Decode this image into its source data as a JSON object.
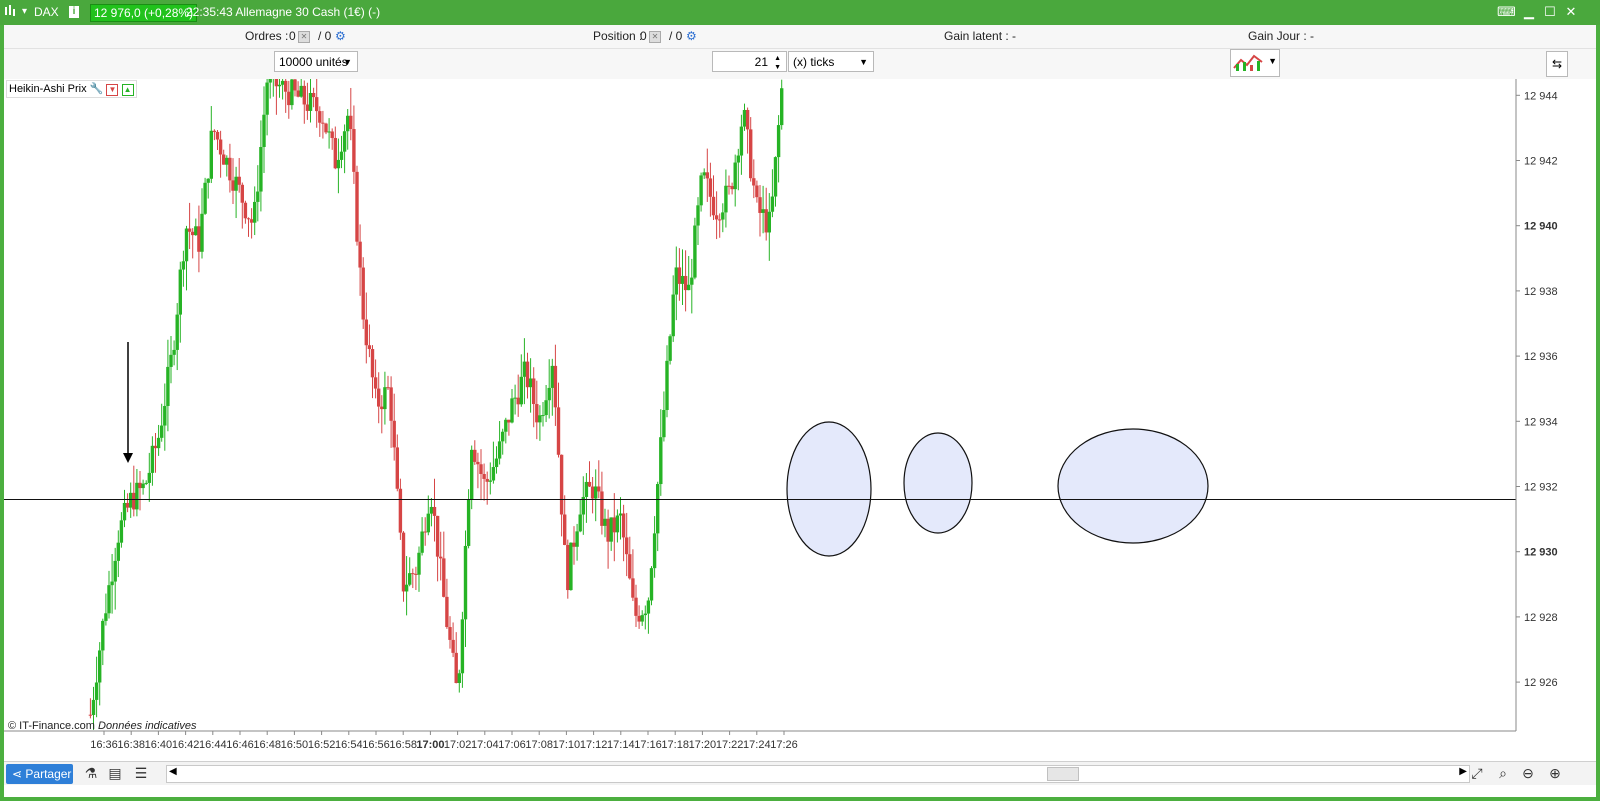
{
  "titlebar": {
    "instrument": "DAX",
    "price_badge": "12 976,0 (+0,28%)",
    "time_title": "22:35:43 Allemagne 30 Cash (1€) (-)"
  },
  "toolbar": {
    "orders_label": "Ordres :",
    "orders_value": "0",
    "orders_slash": "/ 0",
    "position_label": "Position :",
    "position_value": "0",
    "position_slash": "/ 0",
    "gain_latent": "Gain latent : -",
    "gain_jour": "Gain Jour : -"
  },
  "order_bar": {
    "quantity": "10000 unités",
    "ticks_value": "21",
    "ticks_unit": "(x) ticks"
  },
  "indicator": {
    "label": "Heikin-Ashi Prix"
  },
  "footer": {
    "source": "© IT-Finance.com",
    "note": "Données indicatives",
    "share": "Partager"
  },
  "colors": {
    "up": "#26b325",
    "down": "#d64545",
    "accent": "#4aa83d",
    "ellipse_fill": "#e4e9fb"
  },
  "chart_data": {
    "type": "candlestick",
    "style": "Heikin-Ashi",
    "ylim": [
      12924.5,
      12944.5
    ],
    "y_ticks": [
      {
        "v": 12944,
        "label": "12 944",
        "bold": false
      },
      {
        "v": 12942,
        "label": "12 942",
        "bold": false
      },
      {
        "v": 12940,
        "label": "12 940",
        "bold": true
      },
      {
        "v": 12938,
        "label": "12 938",
        "bold": false
      },
      {
        "v": 12936,
        "label": "12 936",
        "bold": false
      },
      {
        "v": 12934,
        "label": "12 934",
        "bold": false
      },
      {
        "v": 12932,
        "label": "12 932",
        "bold": false
      },
      {
        "v": 12930,
        "label": "12 930",
        "bold": true
      },
      {
        "v": 12928,
        "label": "12 928",
        "bold": false
      },
      {
        "v": 12926,
        "label": "12 926",
        "bold": false
      }
    ],
    "x_ticks": [
      {
        "t": "16:36",
        "bold": false
      },
      {
        "t": "16:38",
        "bold": false
      },
      {
        "t": "16:40",
        "bold": false
      },
      {
        "t": "16:42",
        "bold": false
      },
      {
        "t": "16:44",
        "bold": false
      },
      {
        "t": "16:46",
        "bold": false
      },
      {
        "t": "16:48",
        "bold": false
      },
      {
        "t": "16:50",
        "bold": false
      },
      {
        "t": "16:52",
        "bold": false
      },
      {
        "t": "16:54",
        "bold": false
      },
      {
        "t": "16:56",
        "bold": false
      },
      {
        "t": "16:58",
        "bold": false
      },
      {
        "t": "17:00",
        "bold": true
      },
      {
        "t": "17:02",
        "bold": false
      },
      {
        "t": "17:04",
        "bold": false
      },
      {
        "t": "17:06",
        "bold": false
      },
      {
        "t": "17:08",
        "bold": false
      },
      {
        "t": "17:10",
        "bold": false
      },
      {
        "t": "17:12",
        "bold": false
      },
      {
        "t": "17:14",
        "bold": false
      },
      {
        "t": "17:16",
        "bold": false
      },
      {
        "t": "17:18",
        "bold": false
      },
      {
        "t": "17:20",
        "bold": false
      },
      {
        "t": "17:22",
        "bold": false
      },
      {
        "t": "17:24",
        "bold": false
      },
      {
        "t": "17:26",
        "bold": false
      }
    ],
    "price_path": [
      [
        "16:35",
        12925.0
      ],
      [
        "16:36",
        12928.0
      ],
      [
        "16:37",
        12930.5
      ],
      [
        "16:38",
        12931.6
      ],
      [
        "16:39",
        12932.0
      ],
      [
        "16:40",
        12933.5
      ],
      [
        "16:41",
        12936.0
      ],
      [
        "16:42",
        12940.0
      ],
      [
        "16:43",
        12939.5
      ],
      [
        "16:44",
        12943.0
      ],
      [
        "16:45",
        12942.0
      ],
      [
        "16:46",
        12941.0
      ],
      [
        "16:47",
        12940.0
      ],
      [
        "16:48",
        12944.5
      ],
      [
        "16:50",
        12944.0
      ],
      [
        "16:52",
        12943.5
      ],
      [
        "16:53",
        12942.0
      ],
      [
        "16:54",
        12943.5
      ],
      [
        "16:55",
        12937.5
      ],
      [
        "16:56",
        12934.5
      ],
      [
        "16:57",
        12935.0
      ],
      [
        "16:58",
        12929.0
      ],
      [
        "16:59",
        12929.5
      ],
      [
        "17:00",
        12932.0
      ],
      [
        "17:01",
        12928.5
      ],
      [
        "17:02",
        12925.5
      ],
      [
        "17:03",
        12933.5
      ],
      [
        "17:04",
        12932.0
      ],
      [
        "17:05",
        12933.0
      ],
      [
        "17:06",
        12934.5
      ],
      [
        "17:07",
        12935.5
      ],
      [
        "17:08",
        12934.0
      ],
      [
        "17:09",
        12936.0
      ],
      [
        "17:10",
        12929.0
      ],
      [
        "17:11",
        12931.5
      ],
      [
        "17:12",
        12932.0
      ],
      [
        "17:13",
        12930.5
      ],
      [
        "17:14",
        12931.0
      ],
      [
        "17:15",
        12928.0
      ],
      [
        "17:16",
        12928.5
      ],
      [
        "17:17",
        12933.5
      ],
      [
        "17:18",
        12938.5
      ],
      [
        "17:19",
        12938.0
      ],
      [
        "17:20",
        12941.5
      ],
      [
        "17:21",
        12940.5
      ],
      [
        "17:22",
        12941.0
      ],
      [
        "17:23",
        12943.5
      ],
      [
        "17:24",
        12940.5
      ],
      [
        "17:25",
        12940.0
      ],
      [
        "17:26",
        12945.0
      ]
    ],
    "reference_line": {
      "value": 12931.6,
      "label": "12 931,6"
    }
  }
}
